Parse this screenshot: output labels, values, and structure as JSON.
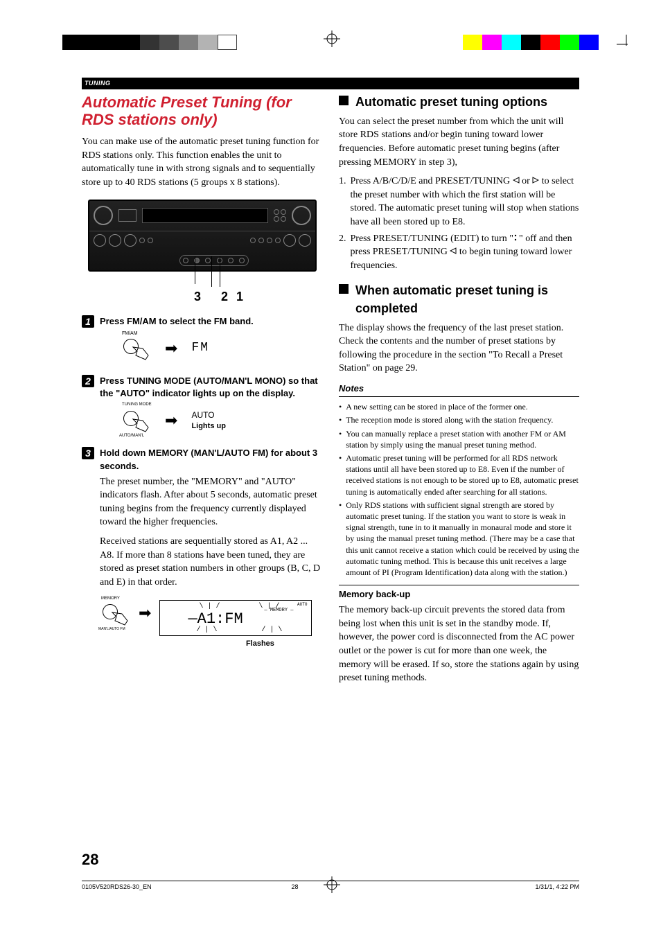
{
  "chapter": "TUNING",
  "section_title": "Automatic Preset Tuning (for RDS stations only)",
  "intro": "You can make use of the automatic preset tuning function for RDS stations only. This function enables the unit to automatically tune in with strong signals and to sequentially store up to 40 RDS stations (5 groups x 8 stations).",
  "indicator_nums": "3 21",
  "steps": [
    {
      "num": "1",
      "title": "Press FM/AM to select the FM band.",
      "btn_label": "FM/AM",
      "lcd": "FM"
    },
    {
      "num": "2",
      "title": "Press TUNING MODE (AUTO/MAN'L MONO) so that the \"AUTO\" indicator lights up on the display.",
      "btn_label_top": "TUNING MODE",
      "btn_label_bot": "AUTO/MAN'L",
      "lcd": "AUTO",
      "lcd_cap": "Lights up"
    },
    {
      "num": "3",
      "title": "Hold down MEMORY (MAN'L/AUTO FM) for about 3 seconds.",
      "body": "The preset number, the \"MEMORY\" and \"AUTO\" indicators flash. After about 5 seconds, automatic preset tuning begins from the frequency currently displayed toward the higher frequencies.",
      "body2": "Received stations are sequentially stored as A1, A2 ... A8. If more than 8 stations have been tuned, they are stored as preset station numbers in other groups (B, C, D and E) in that order.",
      "btn_label_top": "MEMORY",
      "btn_label_bot": "MAN'L/AUTO FM",
      "lcd_seg": "A1:FM",
      "lcd_mem": "MEMORY",
      "lcd_auto": "AUTO",
      "flash_cap": "Flashes"
    }
  ],
  "right": {
    "h1": "Automatic preset tuning options",
    "p1": "You can select the preset number from which the unit will store RDS stations and/or begin tuning toward lower frequencies. Before automatic preset tuning begins (after pressing MEMORY in step 3),",
    "li1a": "Press A/B/C/D/E and PRESET/TUNING ",
    "li1b": " or ",
    "li1c": " to select the preset number with which the first station will be stored. The automatic preset tuning will stop when stations have all been stored up to E8.",
    "li2a": "Press PRESET/TUNING (EDIT) to turn \"",
    "li2b": "\" off and then press PRESET/TUNING ",
    "li2c": " to begin tuning toward lower frequencies.",
    "h2": "When automatic preset tuning is completed",
    "p2": "The display shows the frequency of the last preset station. Check the contents and the number of preset stations by following the procedure in the section \"To Recall a Preset Station\" on page 29.",
    "notes_h": "Notes",
    "notes": [
      "A new setting can be stored in place of the former one.",
      "The reception mode is stored along with the station frequency.",
      "You can manually replace a preset station with another FM or AM station by simply using the manual preset tuning method.",
      "Automatic preset tuning will be performed for all RDS network stations until all have been stored up to E8. Even if the number of received stations is not enough to be stored up to E8, automatic preset tuning is automatically ended after searching for all stations.",
      "Only RDS stations with sufficient signal strength are stored by automatic preset tuning. If the station you want to store is weak in signal strength, tune in to it manually in monaural mode and store it by using the manual preset tuning method. (There may be a case that this unit cannot receive a station which could be received by using the automatic tuning method. This is because this unit receives a large amount of PI (Program Identification) data along with the station.)"
    ],
    "mem_h": "Memory back-up",
    "mem_p": "The memory back-up circuit prevents the stored data from being lost when this unit is set in the standby mode. If, however, the power cord is disconnected from the AC power outlet or the power is cut for more than one week, the memory will be erased. If so, store the stations again by using preset tuning methods."
  },
  "page_num": "28",
  "footer": {
    "left": "0105V520RDS26-30_EN",
    "center": "28",
    "right": "1/31/1, 4:22 PM"
  }
}
